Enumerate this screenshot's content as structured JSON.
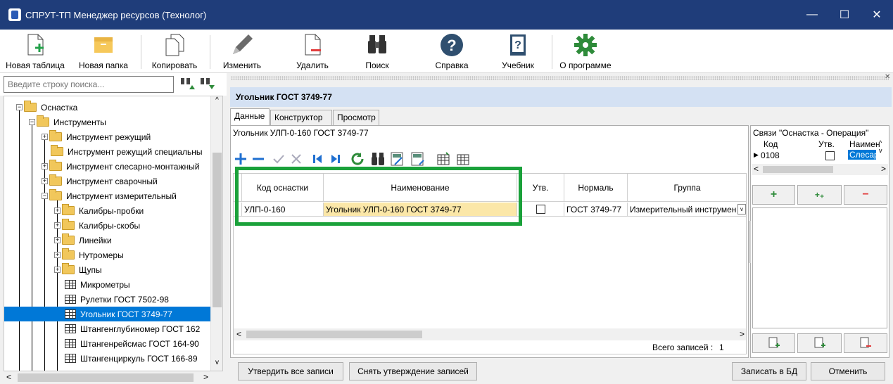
{
  "window": {
    "title": "СПРУТ-ТП Менеджер ресурсов (Технолог)"
  },
  "toolbar": [
    {
      "label": "Новая таблица",
      "icon": "new-table-icon"
    },
    {
      "label": "Новая папка",
      "icon": "new-folder-icon"
    },
    {
      "label": "Копировать",
      "icon": "copy-icon"
    },
    {
      "label": "Изменить",
      "icon": "edit-icon"
    },
    {
      "label": "Удалить",
      "icon": "delete-icon"
    },
    {
      "label": "Поиск",
      "icon": "binoculars-icon"
    },
    {
      "label": "Справка",
      "icon": "help-icon"
    },
    {
      "label": "Учебник",
      "icon": "tutorial-icon"
    },
    {
      "label": "О программе",
      "icon": "gear-icon"
    }
  ],
  "search": {
    "placeholder": "Введите строку поиска..."
  },
  "tree": [
    {
      "label": "Оснастка",
      "type": "folder"
    },
    {
      "label": "Инструменты",
      "type": "folder"
    },
    {
      "label": "Инструмент режущий",
      "type": "folder"
    },
    {
      "label": "Инструмент режущий специальны",
      "type": "folder"
    },
    {
      "label": "Инструмент слесарно-монтажный",
      "type": "folder"
    },
    {
      "label": "Инструмент сварочный",
      "type": "folder"
    },
    {
      "label": "Инструмент измерительный",
      "type": "folder"
    },
    {
      "label": "Калибры-пробки",
      "type": "folder"
    },
    {
      "label": "Калибры-скобы",
      "type": "folder"
    },
    {
      "label": "Линейки",
      "type": "folder"
    },
    {
      "label": "Нутромеры",
      "type": "folder"
    },
    {
      "label": "Щупы",
      "type": "folder"
    },
    {
      "label": "Микрометры",
      "type": "table"
    },
    {
      "label": "Рулетки ГОСТ 7502-98",
      "type": "table"
    },
    {
      "label": "Угольник ГОСТ 3749-77",
      "type": "table",
      "selected": true
    },
    {
      "label": "Штангенглубиномер ГОСТ 162",
      "type": "table"
    },
    {
      "label": "Штангенрейсмас ГОСТ 164-90",
      "type": "table"
    },
    {
      "label": "Штангенциркуль ГОСТ 166-89",
      "type": "table"
    }
  ],
  "header": {
    "title": "Угольник ГОСТ 3749-77"
  },
  "tabs": [
    "Данные",
    "Конструктор",
    "Просмотр"
  ],
  "panel": {
    "caption": "Угольник УЛП-0-160 ГОСТ 3749-77"
  },
  "grid": {
    "columns": [
      "Код оснастки",
      "Наименование",
      "Утв.",
      "Нормаль",
      "Группа"
    ],
    "rows": [
      {
        "code": "УЛП-0-160",
        "name": "Угольник УЛП-0-160 ГОСТ 3749-77",
        "approved": false,
        "normal": "ГОСТ 3749-77",
        "group": "Измерительный инструмен"
      }
    ]
  },
  "footer": {
    "total_label": "Всего записей :",
    "total_value": "1"
  },
  "side": {
    "title": "Связи \"Оснастка - Операция\"",
    "columns": [
      "Код",
      "Утв.",
      "Наимен"
    ],
    "row": {
      "code": "0108",
      "approved": false,
      "name": "Слесарн"
    }
  },
  "buttons": {
    "approve_all": "Утвердить все записи",
    "unapprove": "Снять утверждение записей",
    "save_db": "Записать в БД",
    "cancel": "Отменить"
  },
  "colors": {
    "accent": "#0078d7",
    "highlight": "#1aa13a",
    "titlebar": "#1f3d7a"
  }
}
